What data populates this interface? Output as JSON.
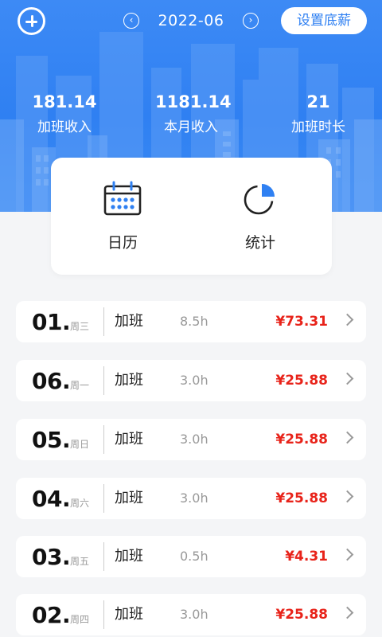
{
  "header": {
    "month": "2022-06",
    "prev_icon": "chevron-left-icon",
    "next_icon": "chevron-right-icon",
    "add_icon": "plus-circle-icon",
    "settings_label": "设置底薪",
    "accent_color": "#2f80f2"
  },
  "stats": [
    {
      "value": "181.14",
      "label": "加班收入"
    },
    {
      "value": "1181.14",
      "label": "本月收入"
    },
    {
      "value": "21",
      "label": "加班时长"
    }
  ],
  "tools": [
    {
      "label": "日历",
      "icon": "calendar-icon"
    },
    {
      "label": "统计",
      "icon": "pie-chart-icon"
    }
  ],
  "records": [
    {
      "day": "01.",
      "weekday": "周三",
      "type": "加班",
      "hours": "8.5h",
      "amount": "¥73.31"
    },
    {
      "day": "06.",
      "weekday": "周一",
      "type": "加班",
      "hours": "3.0h",
      "amount": "¥25.88"
    },
    {
      "day": "05.",
      "weekday": "周日",
      "type": "加班",
      "hours": "3.0h",
      "amount": "¥25.88"
    },
    {
      "day": "04.",
      "weekday": "周六",
      "type": "加班",
      "hours": "3.0h",
      "amount": "¥25.88"
    },
    {
      "day": "03.",
      "weekday": "周五",
      "type": "加班",
      "hours": "0.5h",
      "amount": "¥4.31"
    },
    {
      "day": "02.",
      "weekday": "周四",
      "type": "加班",
      "hours": "3.0h",
      "amount": "¥25.88"
    }
  ],
  "amount_color": "#e8231a"
}
